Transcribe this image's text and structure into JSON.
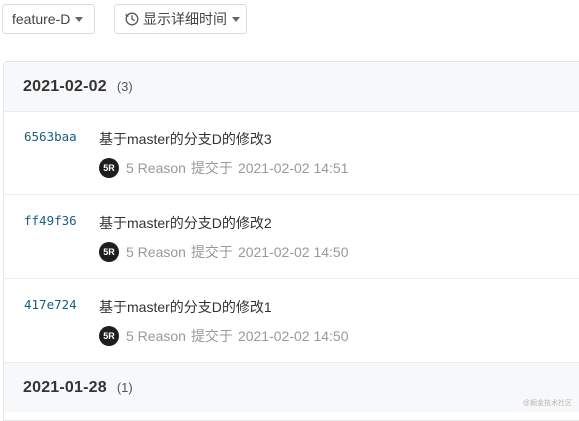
{
  "toolbar": {
    "branch_label": "feature-D",
    "time_toggle_label": "显示详细时间",
    "clock_icon": "clock-icon"
  },
  "groups": [
    {
      "date": "2021-02-02",
      "count": "(3)",
      "commits": [
        {
          "sha": "6563baa",
          "message": "基于master的分支D的修改3",
          "avatar": "5R",
          "author": "5 Reason",
          "verb": "提交于",
          "time": "2021-02-02 14:51"
        },
        {
          "sha": "ff49f36",
          "message": "基于master的分支D的修改2",
          "avatar": "5R",
          "author": "5 Reason",
          "verb": "提交于",
          "time": "2021-02-02 14:50"
        },
        {
          "sha": "417e724",
          "message": "基于master的分支D的修改1",
          "avatar": "5R",
          "author": "5 Reason",
          "verb": "提交于",
          "time": "2021-02-02 14:50"
        }
      ]
    },
    {
      "date": "2021-01-28",
      "count": "(1)"
    }
  ],
  "watermark": "@掘金技术社区",
  "colors": {
    "sha": "#1f5b7a",
    "avatar_bg": "#1e1e1e",
    "header_bg": "#f7f8fa"
  }
}
